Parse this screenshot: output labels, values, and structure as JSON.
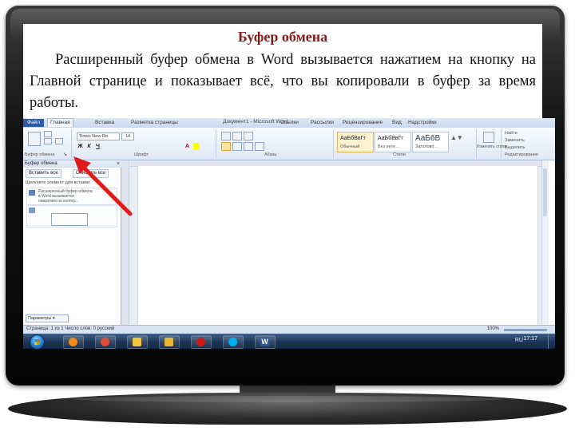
{
  "slide": {
    "title": "Буфер обмена",
    "body": "Расширенный буфер обмена в Word вызывается нажатием на кнопку на Главной странице и показывает всё, что вы копировали в буфер за время работы."
  },
  "word": {
    "window_title": "Документ1 - Microsoft Word",
    "tabs": [
      "Файл",
      "Главная",
      "Вставка",
      "Разметка страницы",
      "Ссылки",
      "Рассылки",
      "Рецензирование",
      "Вид",
      "Надстройки"
    ],
    "font_name": "Times New Ro",
    "font_size": "14",
    "ribbon_groups": [
      "Буфер обмена",
      "Шрифт",
      "Абзац",
      "Стили",
      "Редактирование"
    ],
    "styles": [
      {
        "sample": "АаБбВвГг",
        "name": "Обычный"
      },
      {
        "sample": "АаБбВвГг",
        "name": "Без инте..."
      },
      {
        "sample": "АаБбВ",
        "name": "Заголово..."
      }
    ],
    "change_styles": "Изменить стили",
    "editing": [
      "Найти",
      "Заменить",
      "Выделить"
    ],
    "pane": {
      "title": "Буфер обмена",
      "close": "×",
      "paste_all": "Вставить все",
      "clear_all": "Очистить все",
      "hint": "Щелкните элемент для вставки:",
      "item_text": "Расширенный буфер обмена\nв Word вызывается\nнажатием на кнопку...",
      "options": "Параметры ▾"
    },
    "status": "Страница: 1 из 1   Число слов: 0   русский",
    "zoom": "100%"
  },
  "taskbar": {
    "clock": "17:17",
    "tray_lang": "RU",
    "apps": [
      {
        "icon": "media-player-icon",
        "color": "#f08a1d"
      },
      {
        "icon": "chrome-icon",
        "color": "#dd4b39"
      },
      {
        "icon": "folder-icon",
        "color": "#f3c640"
      },
      {
        "icon": "folder-icon",
        "color": "#e9b63a"
      },
      {
        "icon": "opera-icon",
        "color": "#cc1b1b"
      },
      {
        "icon": "skype-icon",
        "color": "#00aff0"
      },
      {
        "icon": "word-icon",
        "color": "#2b5797",
        "label": "W"
      }
    ]
  },
  "colors": {
    "title": "#8b1a1a",
    "arrow": "#e01b1b",
    "taskbar": "#1d3556"
  }
}
